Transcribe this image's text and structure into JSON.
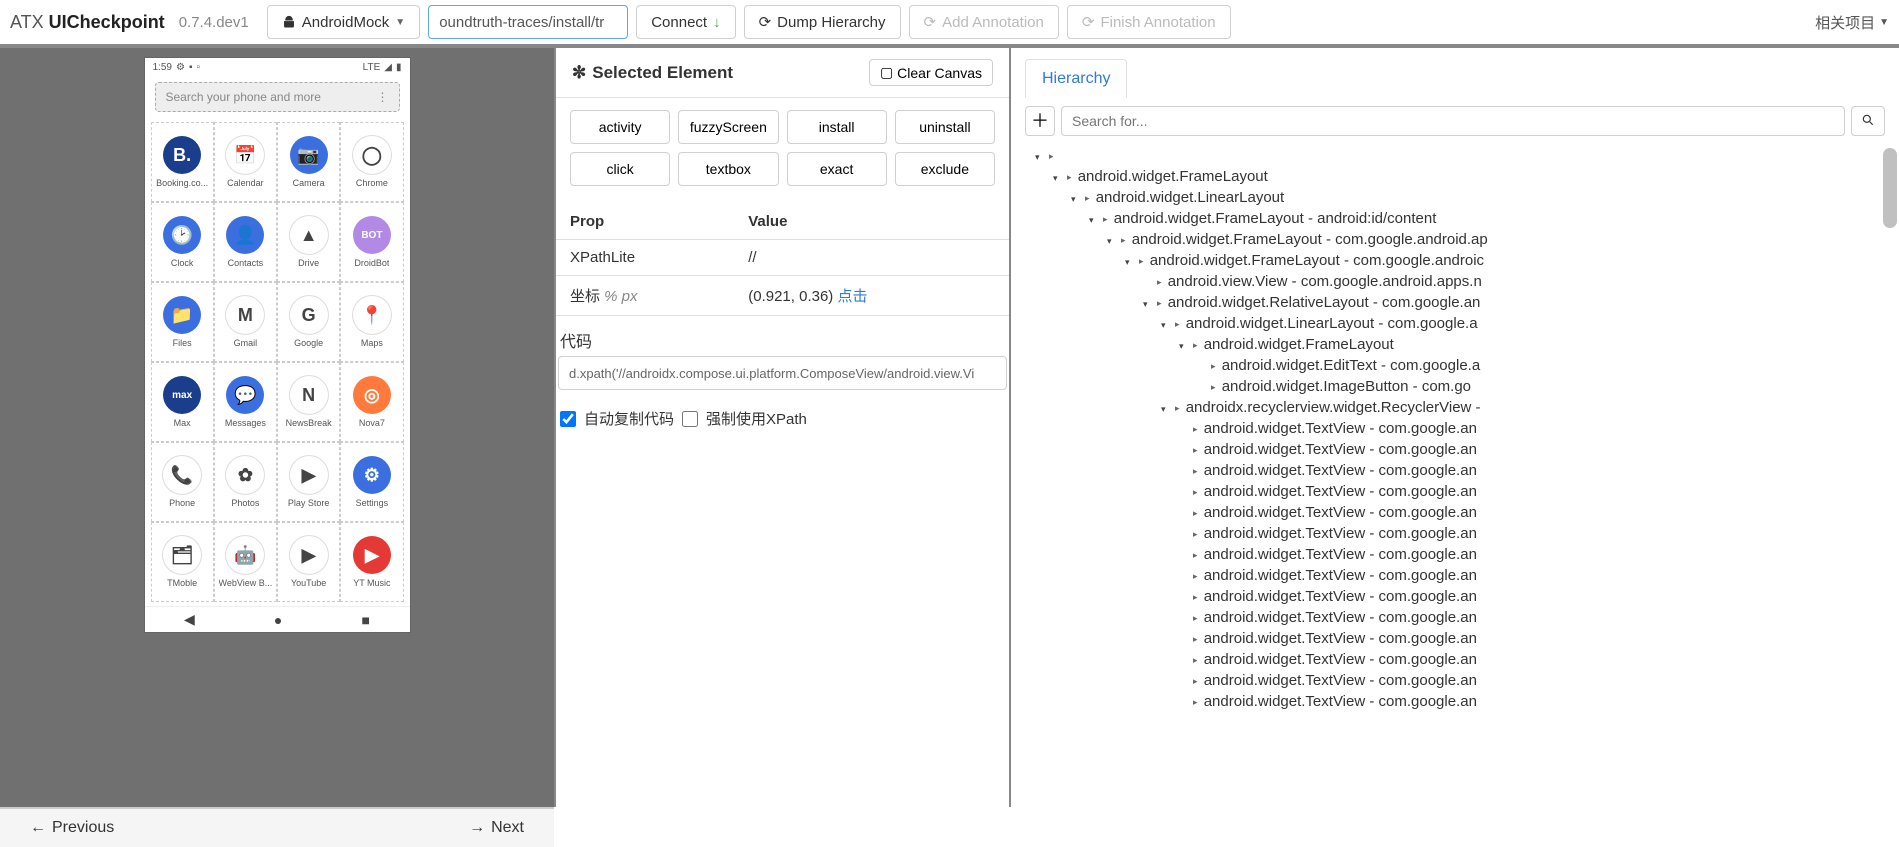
{
  "header": {
    "brand_pre": "ATX ",
    "brand_bold": "UICheckpoint",
    "version": "0.7.4.dev1",
    "device_selector": "AndroidMock",
    "device_input": "oundtruth-traces/install/tr",
    "connect": "Connect",
    "dump": "Dump Hierarchy",
    "addAnno": "Add Annotation",
    "finishAnno": "Finish Annotation",
    "related": "相关项目"
  },
  "phone": {
    "time": "1:59",
    "net": "LTE",
    "search_placeholder": "Search your phone and more",
    "apps": [
      {
        "label": "Booking.co...",
        "bg": "#1a3e8c",
        "glyph": "B."
      },
      {
        "label": "Calendar",
        "bg": "#ffffff",
        "glyph": "📅"
      },
      {
        "label": "Camera",
        "bg": "#3b6fe0",
        "glyph": "📷"
      },
      {
        "label": "Chrome",
        "bg": "#ffffff",
        "glyph": "◯"
      },
      {
        "label": "Clock",
        "bg": "#3b6fe0",
        "glyph": "🕑"
      },
      {
        "label": "Contacts",
        "bg": "#3b6fe0",
        "glyph": "👤"
      },
      {
        "label": "Drive",
        "bg": "#ffffff",
        "glyph": "▲"
      },
      {
        "label": "DroidBot",
        "bg": "#b28ae6",
        "glyph": "BOT"
      },
      {
        "label": "Files",
        "bg": "#3b6fe0",
        "glyph": "📁"
      },
      {
        "label": "Gmail",
        "bg": "#ffffff",
        "glyph": "M"
      },
      {
        "label": "Google",
        "bg": "#ffffff",
        "glyph": "G"
      },
      {
        "label": "Maps",
        "bg": "#ffffff",
        "glyph": "📍"
      },
      {
        "label": "Max",
        "bg": "#1a3e8c",
        "glyph": "max"
      },
      {
        "label": "Messages",
        "bg": "#3b6fe0",
        "glyph": "💬"
      },
      {
        "label": "NewsBreak",
        "bg": "#ffffff",
        "glyph": "N"
      },
      {
        "label": "Nova7",
        "bg": "#ff7a3c",
        "glyph": "◎"
      },
      {
        "label": "Phone",
        "bg": "#ffffff",
        "glyph": "📞"
      },
      {
        "label": "Photos",
        "bg": "#ffffff",
        "glyph": "✿"
      },
      {
        "label": "Play Store",
        "bg": "#ffffff",
        "glyph": "▶"
      },
      {
        "label": "Settings",
        "bg": "#3b6fe0",
        "glyph": "⚙"
      },
      {
        "label": "TMoble",
        "bg": "#ffffff",
        "glyph": "🗂"
      },
      {
        "label": "WebView B...",
        "bg": "#ffffff",
        "glyph": "🤖"
      },
      {
        "label": "YouTube",
        "bg": "#ffffff",
        "glyph": "▶"
      },
      {
        "label": "YT Music",
        "bg": "#e53935",
        "glyph": "▶"
      }
    ]
  },
  "center": {
    "title": "Selected Element",
    "clear": "Clear Canvas",
    "buttons": [
      "activity",
      "fuzzyScreen",
      "install",
      "uninstall",
      "click",
      "textbox",
      "exact",
      "exclude"
    ],
    "propHeader": "Prop",
    "valueHeader": "Value",
    "rows": [
      {
        "prop": "XPathLite",
        "value": "//"
      },
      {
        "prop": "坐标 % px",
        "value": "(0.921, 0.36) ",
        "link": "点击"
      }
    ],
    "codeLabel": "代码",
    "codeValue": "d.xpath('//androidx.compose.ui.platform.ComposeView/android.view.Vi",
    "chk1": "自动复制代码",
    "chk2": "强制使用XPath"
  },
  "right": {
    "tab": "Hierarchy",
    "searchPlaceholder": "Search for...",
    "nodes": [
      {
        "indent": 0,
        "t": "exp",
        "label": ""
      },
      {
        "indent": 1,
        "t": "exp",
        "label": "android.widget.FrameLayout"
      },
      {
        "indent": 2,
        "t": "exp",
        "label": "android.widget.LinearLayout"
      },
      {
        "indent": 3,
        "t": "exp",
        "label": "android.widget.FrameLayout - android:id/content"
      },
      {
        "indent": 4,
        "t": "exp",
        "label": "android.widget.FrameLayout - com.google.android.ap"
      },
      {
        "indent": 5,
        "t": "exp",
        "label": "android.widget.FrameLayout - com.google.androic"
      },
      {
        "indent": 6,
        "t": "leaf",
        "label": "android.view.View - com.google.android.apps.n"
      },
      {
        "indent": 6,
        "t": "exp",
        "label": "android.widget.RelativeLayout - com.google.an"
      },
      {
        "indent": 7,
        "t": "exp",
        "label": "android.widget.LinearLayout - com.google.a"
      },
      {
        "indent": 8,
        "t": "exp",
        "label": "android.widget.FrameLayout"
      },
      {
        "indent": 9,
        "t": "leaf",
        "label": "android.widget.EditText - com.google.a"
      },
      {
        "indent": 9,
        "t": "leaf",
        "label": "android.widget.ImageButton - com.go"
      },
      {
        "indent": 7,
        "t": "exp",
        "label": "androidx.recyclerview.widget.RecyclerView -"
      },
      {
        "indent": 8,
        "t": "leaf",
        "label": "android.widget.TextView - com.google.an"
      },
      {
        "indent": 8,
        "t": "leaf",
        "label": "android.widget.TextView - com.google.an"
      },
      {
        "indent": 8,
        "t": "leaf",
        "label": "android.widget.TextView - com.google.an"
      },
      {
        "indent": 8,
        "t": "leaf",
        "label": "android.widget.TextView - com.google.an"
      },
      {
        "indent": 8,
        "t": "leaf",
        "label": "android.widget.TextView - com.google.an"
      },
      {
        "indent": 8,
        "t": "leaf",
        "label": "android.widget.TextView - com.google.an"
      },
      {
        "indent": 8,
        "t": "leaf",
        "label": "android.widget.TextView - com.google.an"
      },
      {
        "indent": 8,
        "t": "leaf",
        "label": "android.widget.TextView - com.google.an"
      },
      {
        "indent": 8,
        "t": "leaf",
        "label": "android.widget.TextView - com.google.an"
      },
      {
        "indent": 8,
        "t": "leaf",
        "label": "android.widget.TextView - com.google.an"
      },
      {
        "indent": 8,
        "t": "leaf",
        "label": "android.widget.TextView - com.google.an"
      },
      {
        "indent": 8,
        "t": "leaf",
        "label": "android.widget.TextView - com.google.an"
      },
      {
        "indent": 8,
        "t": "leaf",
        "label": "android.widget.TextView - com.google.an"
      },
      {
        "indent": 8,
        "t": "leaf",
        "label": "android.widget.TextView - com.google.an"
      }
    ]
  },
  "footer": {
    "prev": "Previous",
    "next": "Next"
  }
}
